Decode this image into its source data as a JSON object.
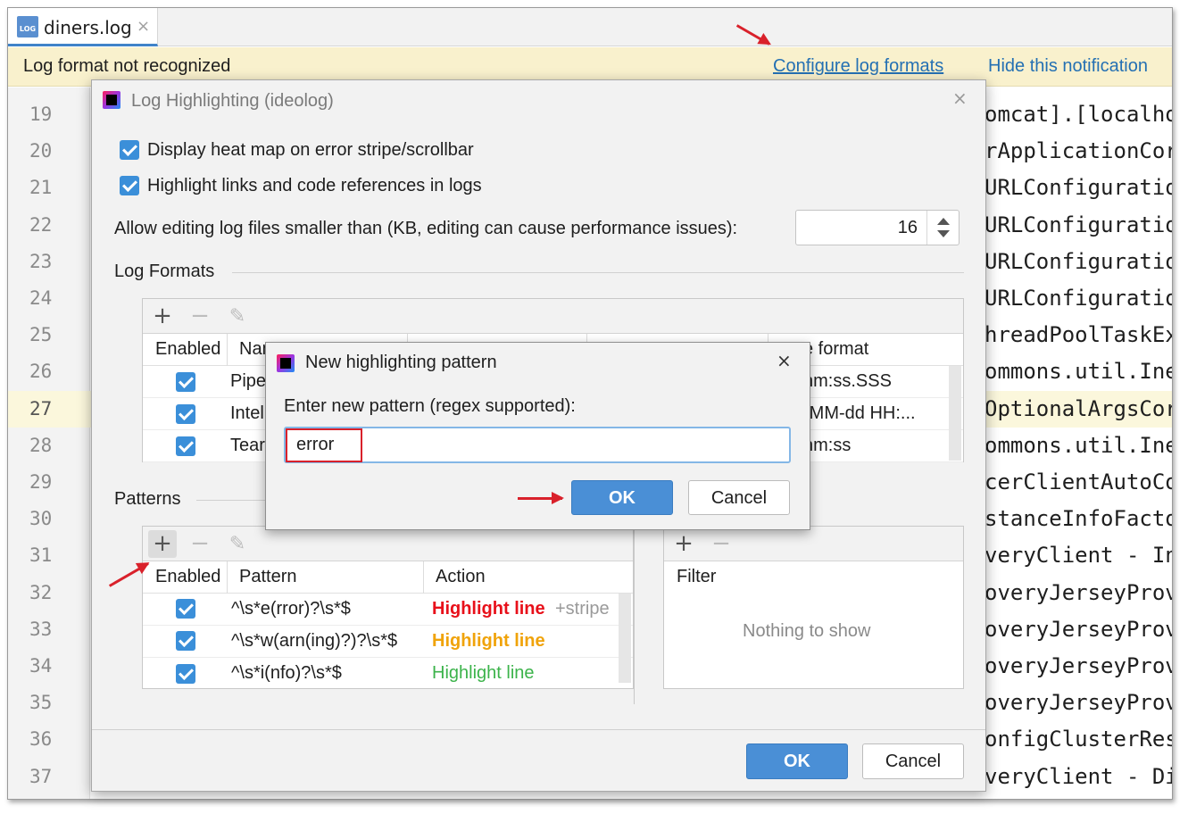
{
  "tab": {
    "icon_text": "LOG",
    "title": "diners.log",
    "close": "×"
  },
  "notification": {
    "message": "Log format not recognized",
    "configure_link": "Configure log formats",
    "hide_link": "Hide this notification"
  },
  "editor": {
    "line_numbers": [
      "19",
      "20",
      "21",
      "22",
      "23",
      "24",
      "25",
      "26",
      "27",
      "28",
      "29",
      "30",
      "31",
      "32",
      "33",
      "34",
      "35",
      "36",
      "37"
    ],
    "current_line": "27",
    "visible_code": [
      "omcat].[localho",
      "rApplicationCor",
      "URLConfiguratio",
      "URLConfiguratio",
      "URLConfiguratio",
      "URLConfiguratio",
      "hreadPoolTaskEx",
      "ommons.util.Ine",
      "OptionalArgsCor",
      "ommons.util.Ine",
      "cerClientAutoCo",
      "stanceInfoFacto",
      "veryClient - In",
      "overyJerseyProv",
      "overyJerseyProv",
      "overyJerseyProv",
      "overyJerseyProv",
      "onfigClusterRes",
      "veryClient - Di"
    ]
  },
  "dialog": {
    "title": "Log Highlighting (ideolog)",
    "close": "×",
    "heatmap_label": "Display heat map on error stripe/scrollbar",
    "links_label": "Highlight links and code references in logs",
    "edit_limit_label": "Allow editing log files smaller than (KB, editing can cause performance issues):",
    "edit_limit_value": "16",
    "log_formats_heading": "Log Formats",
    "formats_columns": {
      "enabled": "Enabled",
      "name": "Nam",
      "time_format": "e format"
    },
    "formats_rows": [
      {
        "name": "Pipe",
        "time": "nm:ss.SSS"
      },
      {
        "name": "Intel",
        "time": "-MM-dd HH:..."
      },
      {
        "name": "Tear",
        "time": "nm:ss"
      }
    ],
    "patterns_heading": "Patterns",
    "patterns_columns": {
      "enabled": "Enabled",
      "pattern": "Pattern",
      "action": "Action"
    },
    "patterns_rows": [
      {
        "pattern": "^\\s*e(rror)?\\s*$",
        "action": "Highlight line",
        "extra": "+stripe",
        "color": "#e8101a"
      },
      {
        "pattern": "^\\s*w(arn(ing)?)?\\s*$",
        "action": "Highlight line",
        "extra": "",
        "color": "#f0a30a"
      },
      {
        "pattern": "^\\s*i(nfo)?\\s*$",
        "action": "Highlight line",
        "extra": "",
        "color": "#3bb34a"
      }
    ],
    "filter_column": "Filter",
    "filter_empty": "Nothing to show",
    "ok": "OK",
    "cancel": "Cancel"
  },
  "sub_dialog": {
    "title": "New highlighting pattern",
    "close": "×",
    "prompt": "Enter new pattern (regex supported):",
    "input_value": "error",
    "ok": "OK",
    "cancel": "Cancel"
  },
  "icons": {
    "add": "+",
    "remove": "−",
    "edit": "✎"
  }
}
